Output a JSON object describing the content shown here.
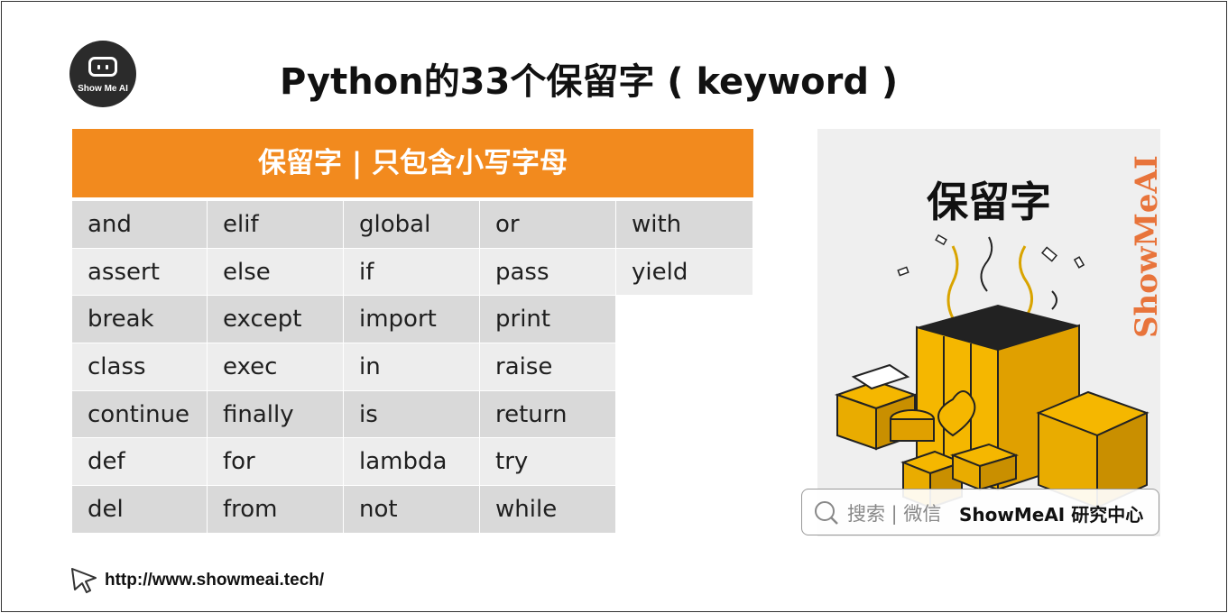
{
  "header": {
    "logo_text": "Show Me AI",
    "title": "Python的33个保留字 ( keyword )"
  },
  "table": {
    "header": "保留字 | 只包含小写字母",
    "rows": [
      [
        "and",
        "elif",
        "global",
        "or",
        "with"
      ],
      [
        "assert",
        "else",
        "if",
        "pass",
        "yield"
      ],
      [
        "break",
        "except",
        "import",
        "print",
        ""
      ],
      [
        "class",
        "exec",
        "in",
        "raise",
        ""
      ],
      [
        "continue",
        "finally",
        "is",
        "return",
        ""
      ],
      [
        "def",
        "for",
        "lambda",
        "try",
        ""
      ],
      [
        "del",
        "from",
        "not",
        "while",
        ""
      ]
    ]
  },
  "illustration": {
    "title": "保留字",
    "side_text": "ShowMeAI"
  },
  "search": {
    "prompt": "搜索 | 微信",
    "brand": "ShowMeAI 研究中心"
  },
  "footer": {
    "url": "http://www.showmeai.tech/"
  },
  "colors": {
    "accent_orange": "#f28a1e",
    "row_dark": "#d9d9d9",
    "row_light": "#ededed",
    "box_yellow": "#f5b700"
  },
  "icons": [
    "logo-icon",
    "search-icon",
    "cursor-icon"
  ]
}
